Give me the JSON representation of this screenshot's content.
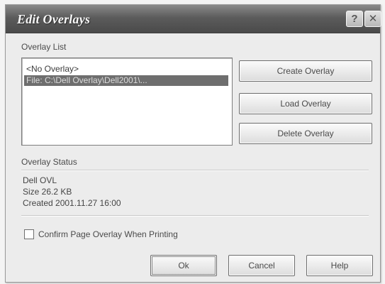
{
  "dialog": {
    "title": "Edit Overlays",
    "help_glyph": "?",
    "close_glyph": "✕"
  },
  "overlay_list": {
    "label": "Overlay List",
    "items": [
      {
        "text": "<No Overlay>",
        "selected": false
      },
      {
        "text": "File: C:\\Dell Overlay\\Dell2001\\...",
        "selected": true
      }
    ]
  },
  "actions": {
    "create": "Create Overlay",
    "load": "Load Overlay",
    "delete": "Delete Overlay"
  },
  "status": {
    "label": "Overlay Status",
    "lines": [
      "Dell OVL",
      "Size 26.2 KB",
      "Created 2001.11.27 16:00"
    ]
  },
  "confirm_checkbox": {
    "label": "Confirm Page Overlay When Printing",
    "checked": false
  },
  "footer": {
    "ok": "Ok",
    "cancel": "Cancel",
    "help": "Help"
  }
}
